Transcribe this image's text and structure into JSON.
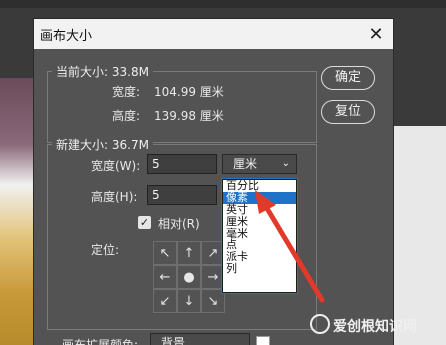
{
  "dialog": {
    "title": "画布大小",
    "close_icon": "close-icon"
  },
  "current_size": {
    "legend": "当前大小: 33.8M",
    "width_label": "宽度:",
    "width_value": "104.99 厘米",
    "height_label": "高度:",
    "height_value": "139.98 厘米"
  },
  "new_size": {
    "legend": "新建大小: 36.7M",
    "width_label": "宽度(W):",
    "width_value": "5",
    "width_unit": "厘米",
    "height_label": "高度(H):",
    "height_value": "5",
    "relative_label": "相对(R)",
    "relative_checked": true,
    "anchor_label": "定位:",
    "anchor_arrows": [
      "↖",
      "↑",
      "↗",
      "←",
      "●",
      "→",
      "↙",
      "↓",
      "↘"
    ]
  },
  "unit_dropdown": {
    "options": [
      "百分比",
      "像素",
      "英寸",
      "厘米",
      "毫米",
      "点",
      "派卡",
      "列"
    ],
    "highlighted": "像素"
  },
  "buttons": {
    "ok": "确定",
    "reset": "复位"
  },
  "extension_color": {
    "label": "画布扩展颜色:",
    "value": "背景"
  },
  "watermark": "爱创根知识网",
  "colors": {
    "dialog_bg": "#535353",
    "highlight": "#1e73c8",
    "arrow": "#e23a2a"
  }
}
